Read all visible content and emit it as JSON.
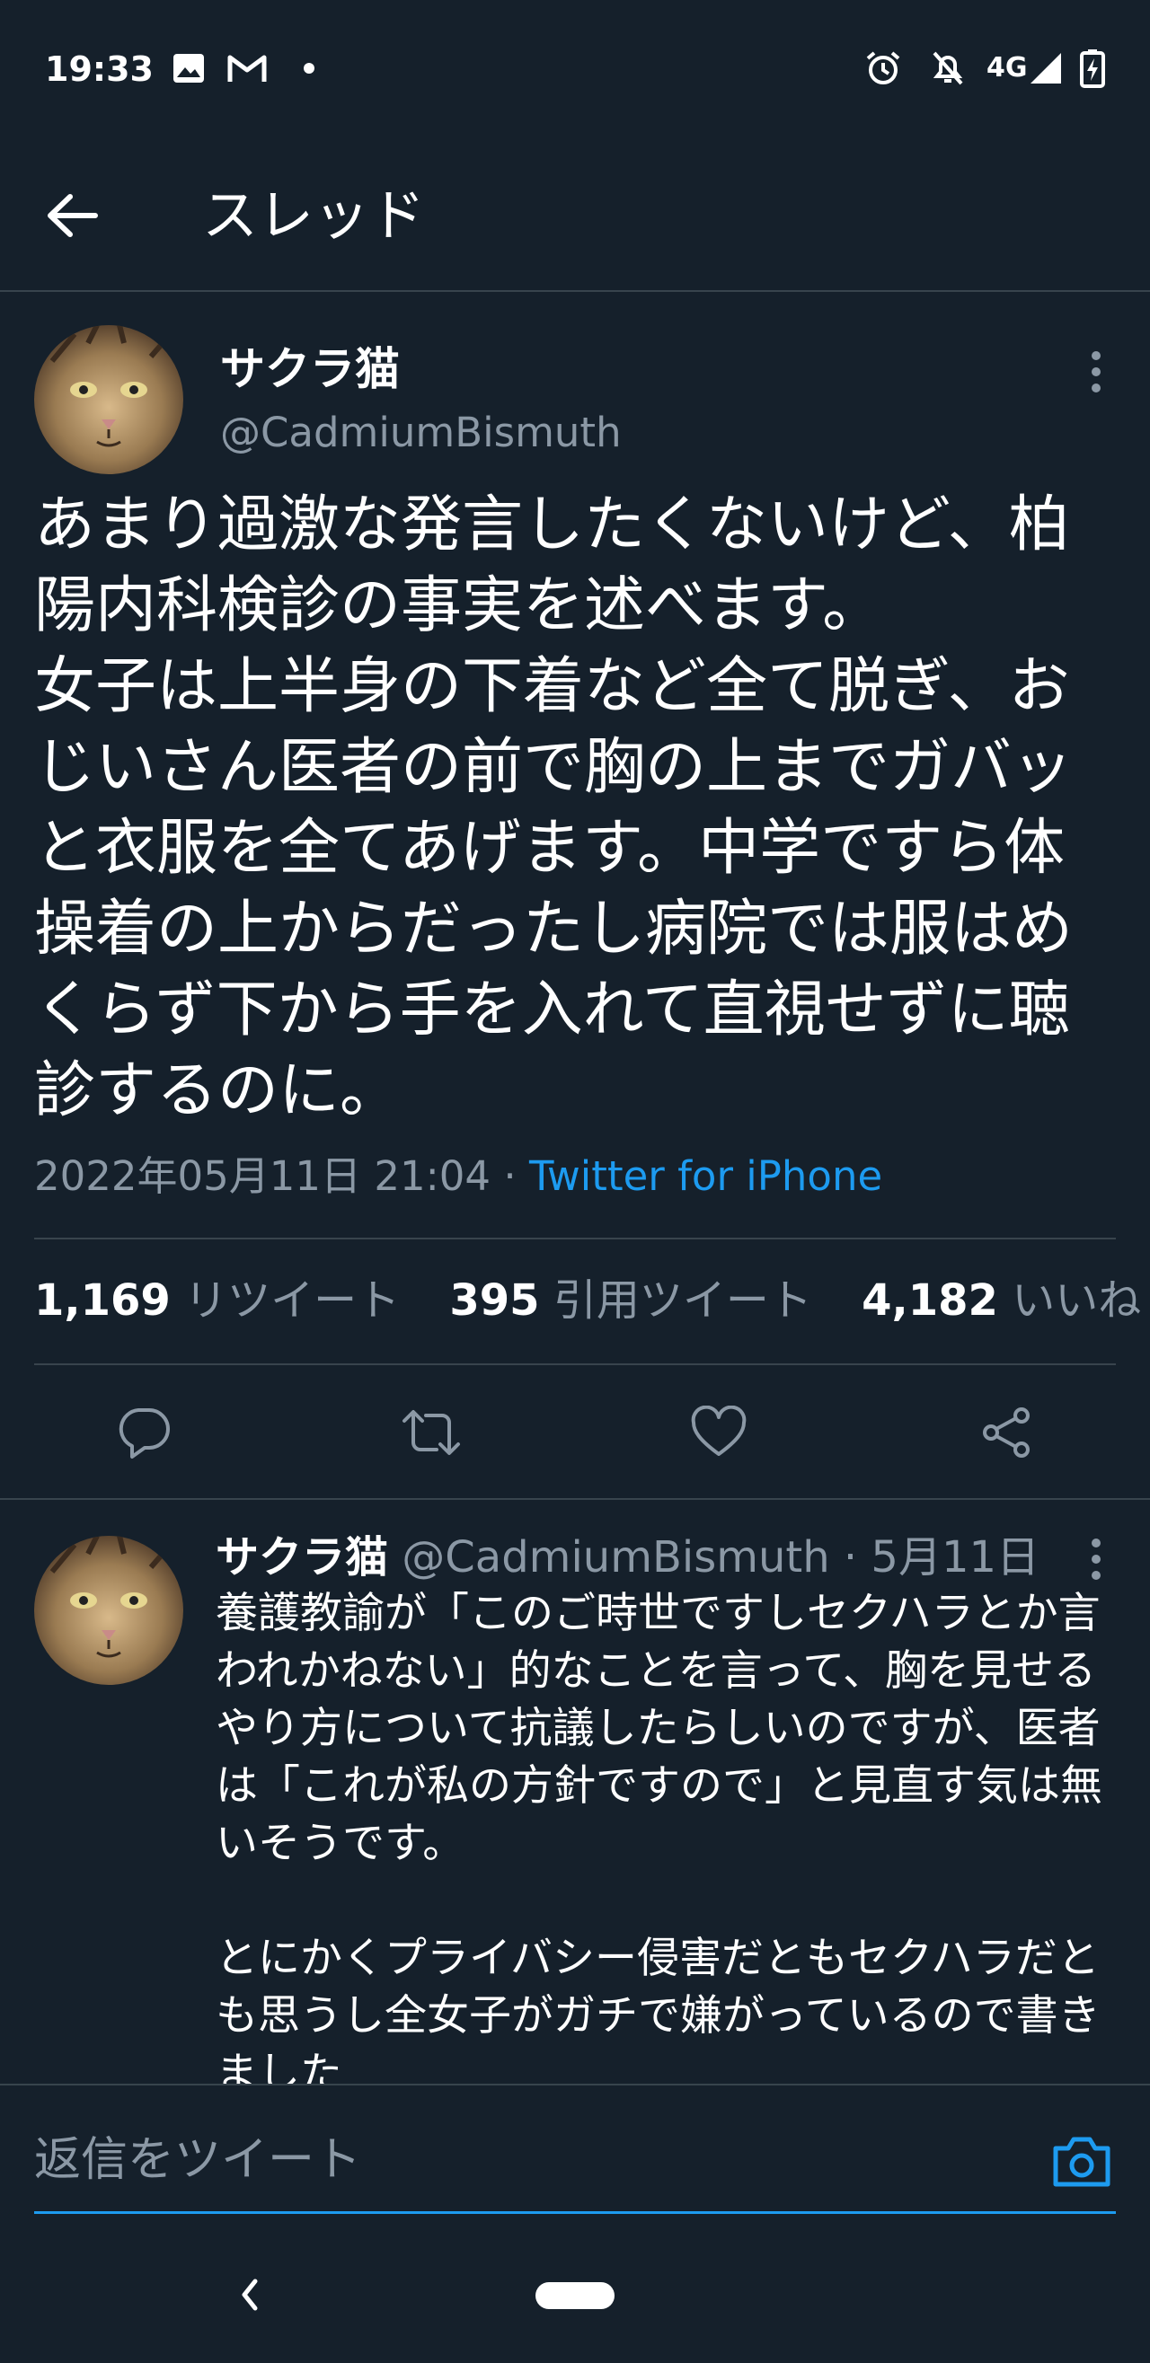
{
  "status_bar": {
    "time": "19:33",
    "network": "4G",
    "icons": [
      "image-icon",
      "gmail-icon",
      "dot-icon",
      "alarm-icon",
      "mute-icon",
      "signal-icon",
      "battery-charging-icon"
    ]
  },
  "header": {
    "title": "スレッド",
    "back_icon": "arrow-left-icon"
  },
  "main_tweet": {
    "display_name": "サクラ猫",
    "handle": "@CadmiumBismuth",
    "text": "あまり過激な発言したくないけど、柏陽内科検診の事実を述べます。\n女子は上半身の下着など全て脱ぎ、おじいさん医者の前で胸の上までガバッと衣服を全てあげます。中学ですら体操着の上からだったし病院では服はめくらず下から手を入れて直視せずに聴診するのに。",
    "timestamp": "2022年05月11日 21:04",
    "separator": " · ",
    "source": "Twitter for iPhone",
    "stats": [
      {
        "count": "1,169",
        "label": "リツイート"
      },
      {
        "count": "395",
        "label": "引用ツイート"
      },
      {
        "count": "4,182",
        "label": "いいね"
      }
    ],
    "actions": [
      "reply-icon",
      "retweet-icon",
      "like-icon",
      "share-icon"
    ]
  },
  "reply_tweet": {
    "display_name": "サクラ猫",
    "handle": "@CadmiumBismuth",
    "date": " · 5月11日",
    "text": "養護教諭が「このご時世ですしセクハラとか言われかねない」的なことを言って、胸を見せるやり方について抗議したらしいのですが、医者は「これが私の方針ですので」と見直す気は無いそうです。\n\nとにかくプライバシー侵害だともセクハラだとも思うし全女子がガチで嫌がっているので書きました"
  },
  "compose": {
    "placeholder": "返信をツイート",
    "camera_icon": "camera-icon"
  },
  "colors": {
    "background": "#15202b",
    "accent": "#1d9bf0",
    "secondary_text": "#8b98a5",
    "divider": "#38444d"
  }
}
